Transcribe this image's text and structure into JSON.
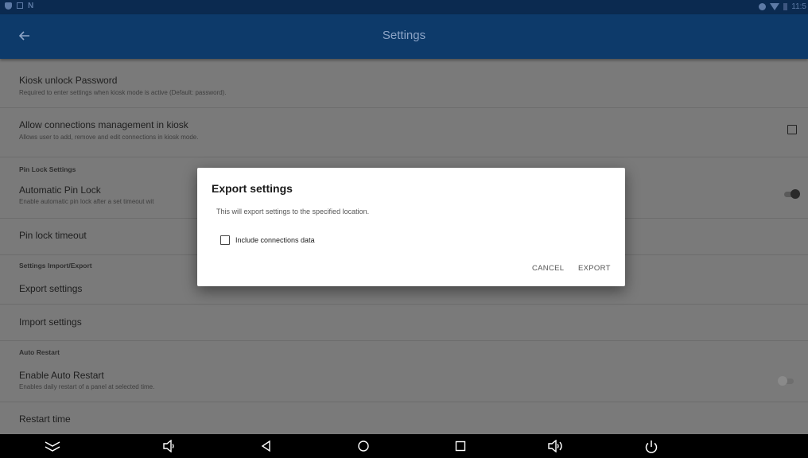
{
  "status_bar": {
    "time": "11:5"
  },
  "app_bar": {
    "title": "Settings",
    "back_icon": "arrow-left-icon"
  },
  "settings": {
    "kiosk_password": {
      "title": "Kiosk unlock Password",
      "subtitle": "Required to enter settings when kiosk mode is active (Default: password)."
    },
    "allow_connections": {
      "title": "Allow connections management in kiosk",
      "subtitle": "Allows user to add, remove and edit connections in kiosk mode.",
      "checked": false
    },
    "pin_lock_section": "Pin Lock Settings",
    "auto_pin_lock": {
      "title": "Automatic Pin Lock",
      "subtitle": "Enable automatic pin lock after a set timeout wit",
      "enabled": true
    },
    "pin_lock_timeout": {
      "title": "Pin lock timeout"
    },
    "import_export_section": "Settings Import/Export",
    "export_settings": {
      "title": "Export settings"
    },
    "import_settings": {
      "title": "Import settings"
    },
    "auto_restart_section": "Auto Restart",
    "enable_auto_restart": {
      "title": "Enable Auto Restart",
      "subtitle": "Enables daily restart of a panel at selected time.",
      "enabled": false
    },
    "restart_time": {
      "title": "Restart time"
    }
  },
  "dialog": {
    "title": "Export settings",
    "message": "This will export settings to the specified location.",
    "checkbox_label": "Include connections data",
    "checkbox_checked": false,
    "cancel_label": "CANCEL",
    "export_label": "EXPORT"
  },
  "nav_bar": {
    "icons": [
      "chevron-down-icon",
      "volume-down-icon",
      "back-icon",
      "home-icon",
      "recents-icon",
      "volume-up-icon",
      "power-icon"
    ]
  },
  "colors": {
    "app_bar": "#0d3a6a",
    "status_bar": "#0b2a50",
    "scrim_background": "#7a7a7a",
    "dialog_background": "#ffffff"
  }
}
